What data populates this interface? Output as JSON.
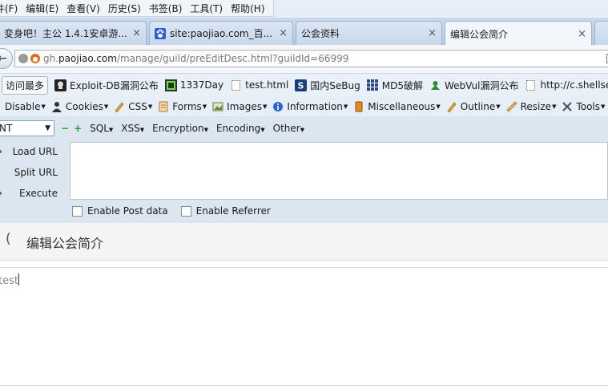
{
  "menubar": {
    "items": [
      "件(F)",
      "编辑(E)",
      "查看(V)",
      "历史(S)",
      "书签(B)",
      "工具(T)",
      "帮助(H)"
    ]
  },
  "tabs": [
    {
      "label": "变身吧！主公 1.4.1安卓游...",
      "icon": "page-icon",
      "active": false
    },
    {
      "label": "site:paojiao.com_百...",
      "icon": "baidu-paw-icon",
      "active": false
    },
    {
      "label": "公会资料",
      "icon": "",
      "active": false
    },
    {
      "label": "编辑公会简介",
      "icon": "",
      "active": true
    }
  ],
  "tab_close": "×",
  "address_bar": {
    "url_prefix": "gh.",
    "url_host": "paojiao.com",
    "url_path": "/manage/guild/preEditDesc.html?guildId=66999"
  },
  "bookmarks": [
    {
      "label": "访问最多",
      "icon": ""
    },
    {
      "label": "Exploit-DB漏洞公布",
      "icon": "exploit-db-icon"
    },
    {
      "label": "1337Day",
      "icon": "1337day-icon"
    },
    {
      "label": "test.html",
      "icon": "page-icon"
    },
    {
      "label": "国内SeBug",
      "icon": "sebug-icon"
    },
    {
      "label": "MD5破解",
      "icon": "md5-grid-icon"
    },
    {
      "label": "WebVul漏洞公布",
      "icon": "webvul-icon"
    },
    {
      "label": "http://c.shellsec.c",
      "icon": "page-icon"
    }
  ],
  "devbar": [
    {
      "label": "Disable",
      "icon": ""
    },
    {
      "label": "Cookies",
      "icon": "cookie-person-icon"
    },
    {
      "label": "CSS",
      "icon": "css-pencil-icon"
    },
    {
      "label": "Forms",
      "icon": "forms-icon"
    },
    {
      "label": "Images",
      "icon": "images-icon"
    },
    {
      "label": "Information",
      "icon": "info-icon"
    },
    {
      "label": "Miscellaneous",
      "icon": "misc-icon"
    },
    {
      "label": "Outline",
      "icon": "outline-pencil-icon"
    },
    {
      "label": "Resize",
      "icon": "resize-ruler-icon"
    },
    {
      "label": "Tools",
      "icon": "tools-icon"
    }
  ],
  "hackbar": {
    "select_value": "NT",
    "menus": [
      "SQL",
      "XSS",
      "Encryption",
      "Encoding",
      "Other"
    ],
    "actions": [
      "Load URL",
      "Split URL",
      "Execute"
    ],
    "checkboxes": [
      "Enable Post data",
      "Enable Referrer"
    ]
  },
  "page": {
    "back_glyph": "(",
    "title": "编辑公会简介",
    "editor_text": "test"
  },
  "colors": {
    "chrome_bg": "#e6eef7",
    "hackbar_bg": "#dce6f0",
    "feed_orange": "#e56a1a"
  }
}
